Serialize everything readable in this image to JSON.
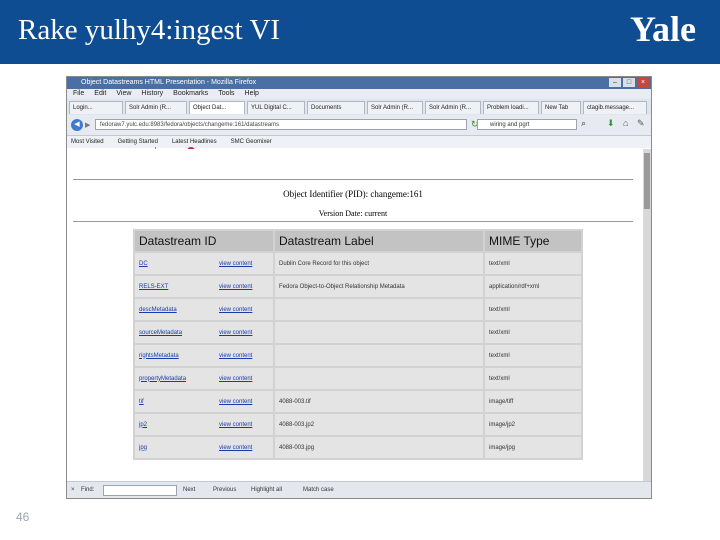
{
  "slide": {
    "title": "Rake yulhy4:ingest VI",
    "logo": "Yale",
    "page_number": "46"
  },
  "browser": {
    "window_title": "Object Datastreams HTML Presentation - Mozilla Firefox",
    "window_buttons": {
      "minimize": "–",
      "maximize": "□",
      "close": "×"
    },
    "menu": [
      "File",
      "Edit",
      "View",
      "History",
      "Bookmarks",
      "Tools",
      "Help"
    ],
    "tabs": [
      {
        "label": "Login..."
      },
      {
        "label": "Solr Admin (R..."
      },
      {
        "label": "Object Dat...",
        "active": true
      },
      {
        "label": "YUL Digital C..."
      },
      {
        "label": "Documents"
      },
      {
        "label": "Solr Admin (R..."
      },
      {
        "label": "Solr Admin (R..."
      },
      {
        "label": "Problem loadi..."
      },
      {
        "label": "New Tab"
      },
      {
        "label": "ctagib.message..."
      }
    ],
    "url": "fedoraw7.yulc.edu:8983/fedora/objects/changeme:161/datastreams",
    "search_value": "wiring and pgrt",
    "bookmarks": [
      "Most Visited",
      "Getting Started",
      "Latest Headlines",
      "SMC Geomixer"
    ]
  },
  "page": {
    "pid_line": "Object Identifier (PID): changeme:161",
    "version_line": "Version Date: current",
    "headers": [
      "Datastream ID",
      "Datastream Label",
      "MIME Type"
    ],
    "rows": [
      {
        "id": "DC",
        "link": "view content",
        "label": "Dublin Core Record for this object",
        "mime": "text/xml"
      },
      {
        "id": "RELS-EXT",
        "link": "view content",
        "label": "Fedora Object-to-Object Relationship Metadata",
        "mime": "application/rdf+xml"
      },
      {
        "id": "descMetadata",
        "link": "view content",
        "label": "",
        "mime": "text/xml"
      },
      {
        "id": "sourceMetadata",
        "link": "view content",
        "label": "",
        "mime": "text/xml"
      },
      {
        "id": "rightsMetadata",
        "link": "view content",
        "label": "",
        "mime": "text/xml"
      },
      {
        "id": "propertyMetadata",
        "link": "view content",
        "label": "",
        "mime": "text/xml"
      },
      {
        "id": "tif",
        "link": "view content",
        "label": "4088-003.tif",
        "mime": "image/tiff"
      },
      {
        "id": "jp2",
        "link": "view content",
        "label": "4088-003.jp2",
        "mime": "image/jp2"
      },
      {
        "id": "jpg",
        "link": "view content",
        "label": "4088-003.jpg",
        "mime": "image/jpg"
      }
    ]
  },
  "findbar": {
    "close": "×",
    "label": "Find:",
    "next": "Next",
    "previous": "Previous",
    "highlight": "Highlight all",
    "match_case": "Match case"
  }
}
